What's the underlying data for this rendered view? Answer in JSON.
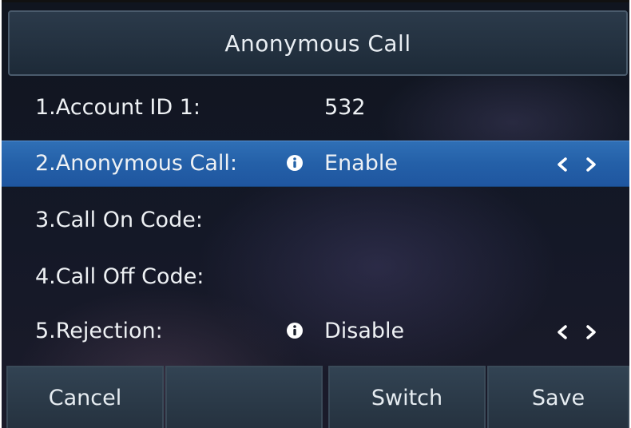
{
  "header": {
    "title": "Anonymous Call"
  },
  "rows": [
    {
      "label": "1.Account ID 1:",
      "value": "532",
      "has_info": false,
      "has_arrows": false,
      "selected": false
    },
    {
      "label": "2.Anonymous Call:",
      "value": "Enable",
      "has_info": true,
      "has_arrows": true,
      "selected": true
    },
    {
      "label": "3.Call On Code:",
      "value": "",
      "has_info": false,
      "has_arrows": false,
      "selected": false
    },
    {
      "label": "4.Call Off Code:",
      "value": "",
      "has_info": false,
      "has_arrows": false,
      "selected": false
    },
    {
      "label": "5.Rejection:",
      "value": "Disable",
      "has_info": true,
      "has_arrows": true,
      "selected": false
    }
  ],
  "softkeys": [
    "Cancel",
    "",
    "Switch",
    "Save"
  ],
  "icons": {
    "info": "info-icon",
    "left": "chevron-left-icon",
    "right": "chevron-right-icon"
  },
  "colors": {
    "selection": "#2563a8",
    "background": "#141827",
    "softkey": "#2b3a48"
  }
}
